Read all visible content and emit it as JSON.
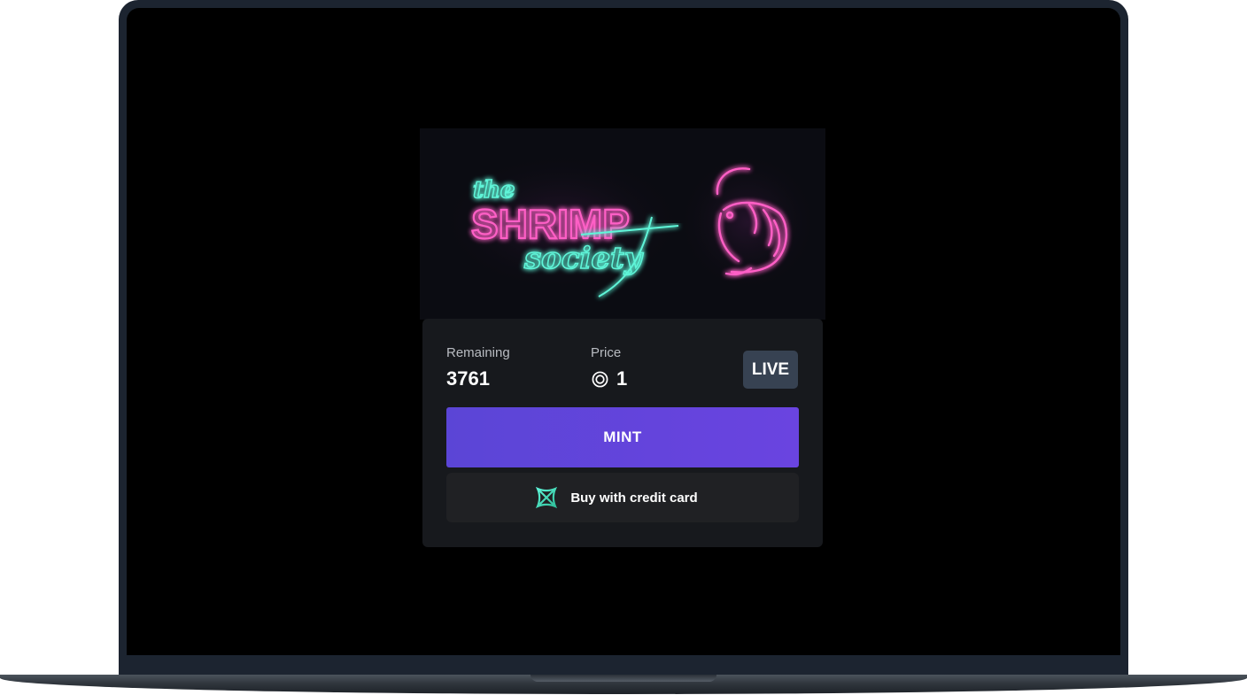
{
  "banner": {
    "logo_line1": "the",
    "logo_line2": "SHRIMP",
    "logo_line3": "society"
  },
  "mint_card": {
    "remaining_label": "Remaining",
    "remaining_value": "3761",
    "price_label": "Price",
    "price_value": "1",
    "price_icon": "sol-coin-icon",
    "status_badge": "LIVE",
    "mint_button_label": "MINT",
    "credit_card_button_label": "Buy with credit card",
    "credit_card_icon": "crossmint-icon"
  },
  "colors": {
    "screen_bg": "#000000",
    "card_bg": "#17191d",
    "mint_button": "#6248dc",
    "live_badge": "#374252",
    "neon_pink": "#ff5fc6",
    "neon_teal": "#5ff5d8"
  }
}
